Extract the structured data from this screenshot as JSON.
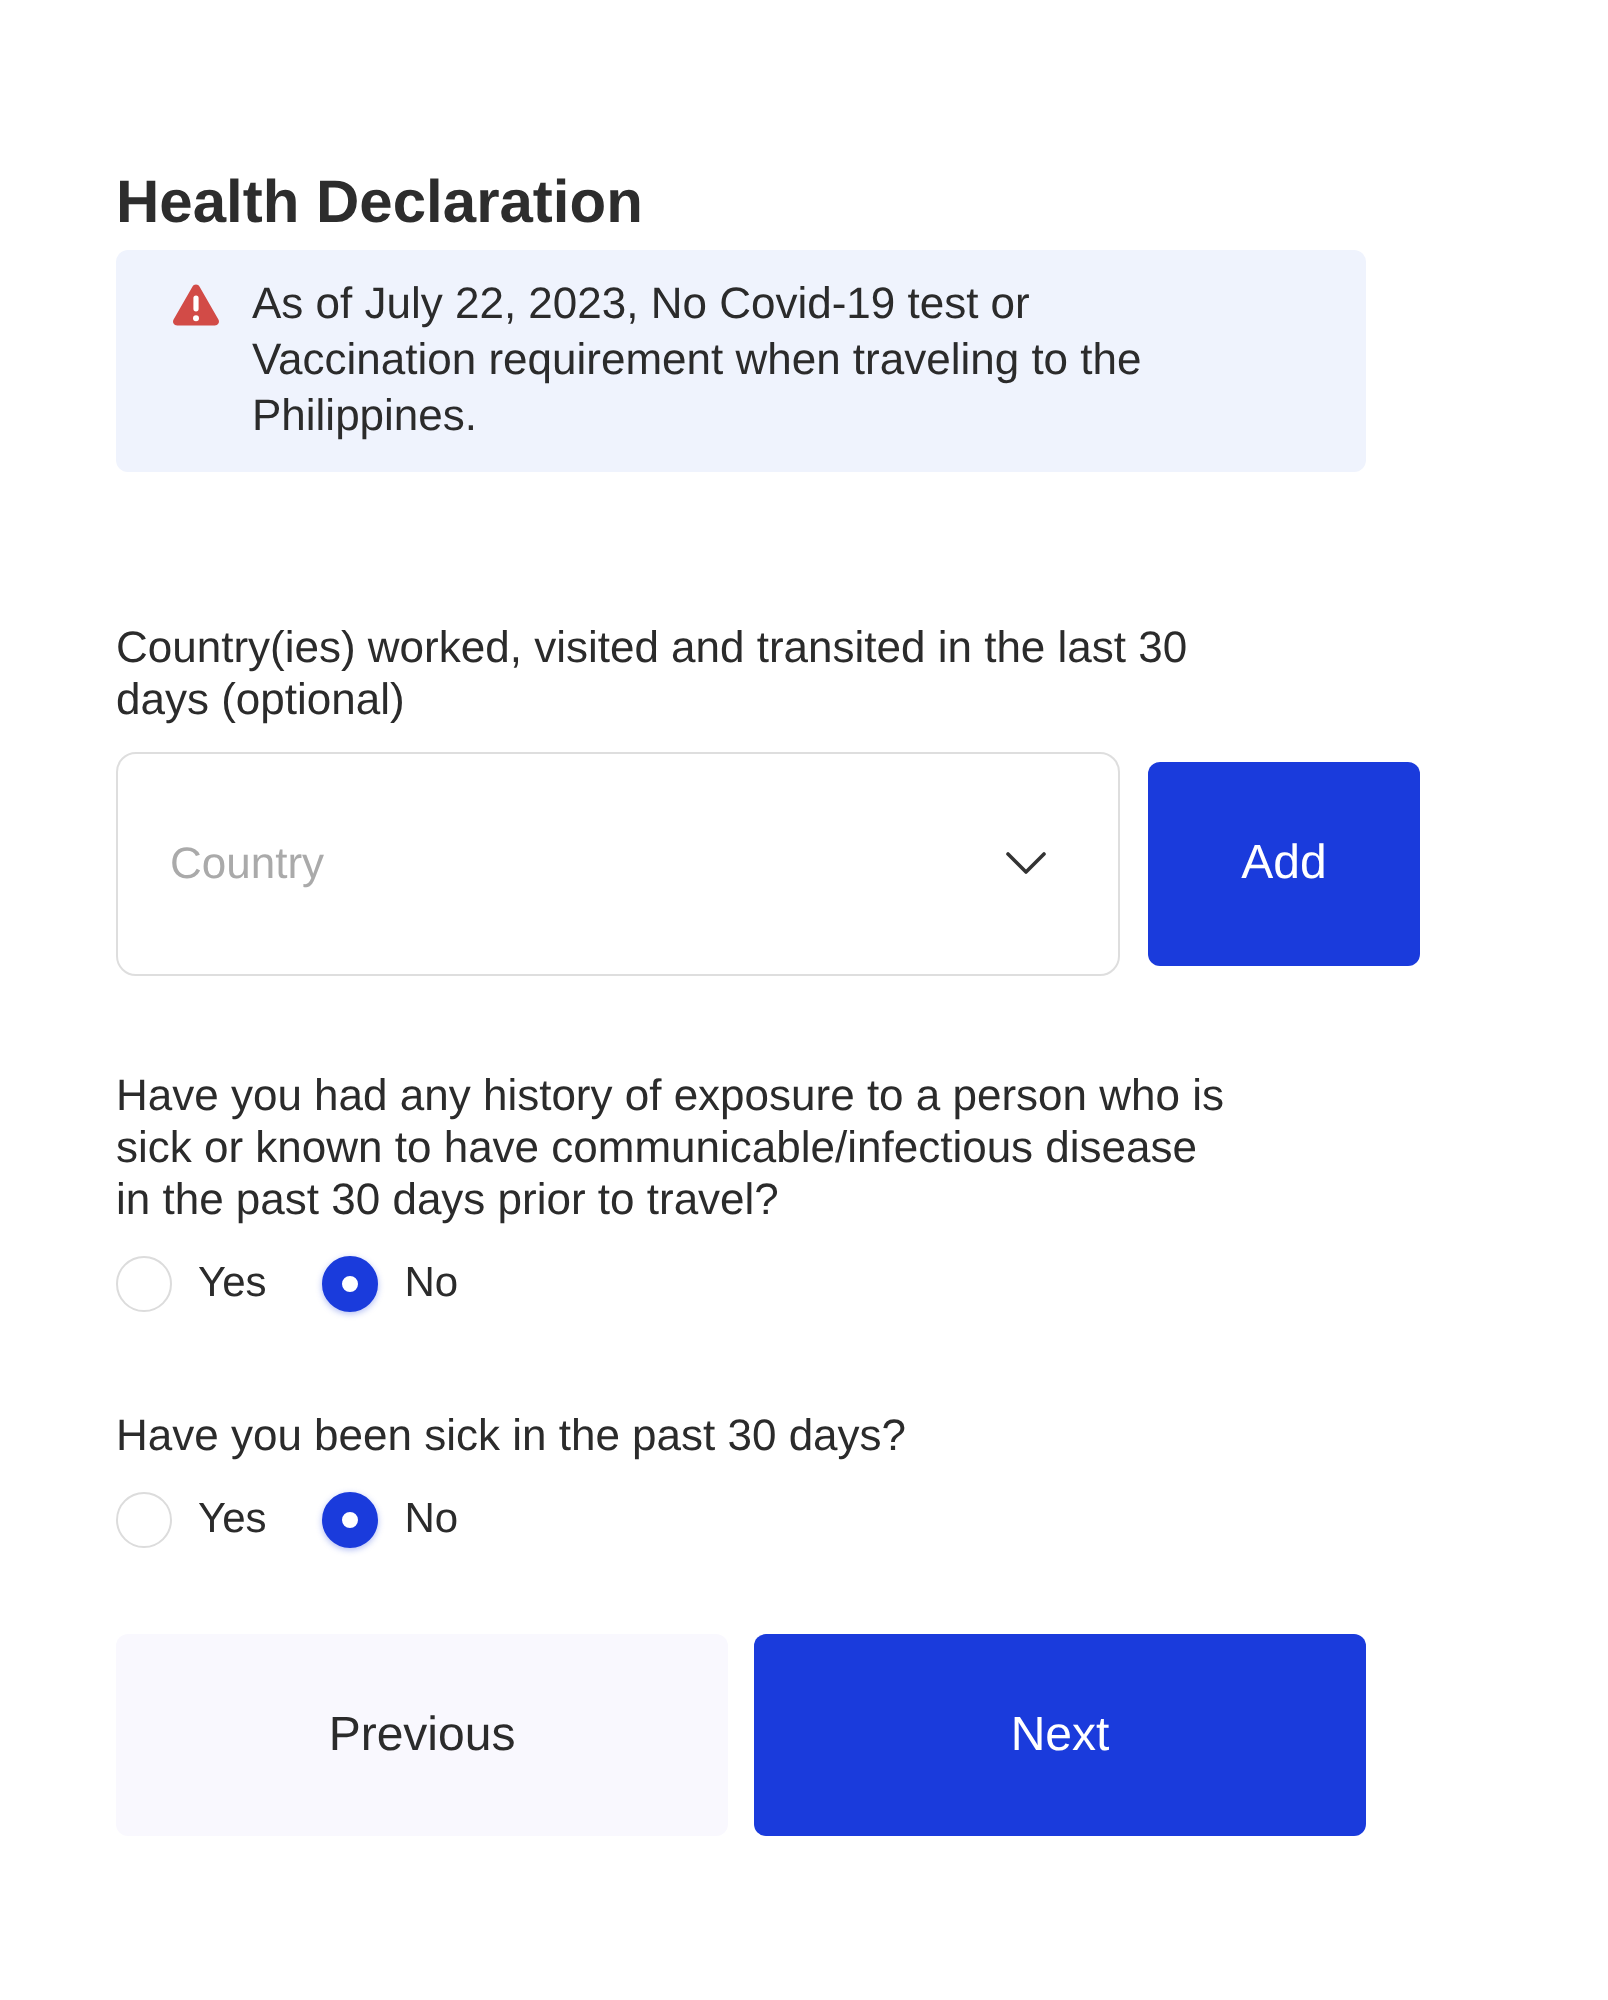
{
  "title": "Health Declaration",
  "notice": {
    "text": "As of July 22, 2023, No Covid-19 test or Vaccination requirement when traveling to the Philippines."
  },
  "country_field": {
    "label": "Country(ies) worked, visited and transited in the last 30 days (optional)",
    "placeholder": "Country",
    "add_button": "Add"
  },
  "questions": [
    {
      "text": "Have you had any history of exposure to a person who is sick or known to have communicable/infectious disease in the past 30 days prior to travel?",
      "options": [
        {
          "label": "Yes",
          "selected": false
        },
        {
          "label": "No",
          "selected": true
        }
      ]
    },
    {
      "text": "Have you been sick in the past 30 days?",
      "options": [
        {
          "label": "Yes",
          "selected": false
        },
        {
          "label": "No",
          "selected": true
        }
      ]
    }
  ],
  "buttons": [
    {
      "label": "Previous",
      "kind": "secondary"
    },
    {
      "label": "Next",
      "kind": "primary"
    }
  ]
}
